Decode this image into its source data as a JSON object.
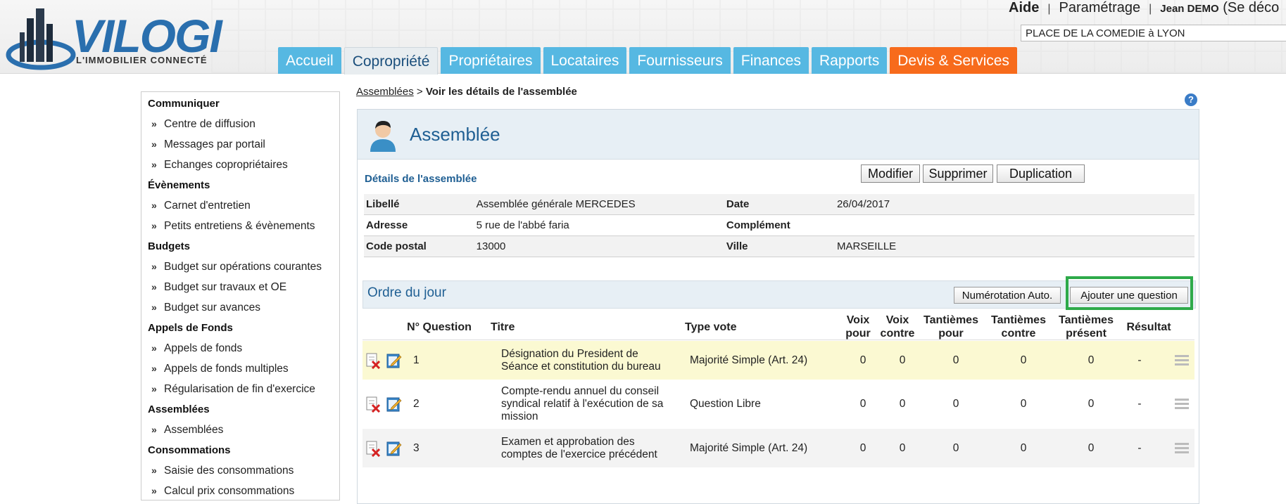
{
  "header": {
    "logo_text": "VILOGI",
    "logo_tagline": "L'IMMOBILIER CONNECTÉ",
    "links": {
      "aide": "Aide",
      "parametrage": "Paramétrage",
      "user": "Jean DEMO",
      "logout": "(Se déco"
    },
    "separator": "|",
    "copro_field": "PLACE DE LA COMEDIE à LYON",
    "tabs": [
      "Accueil",
      "Copropriété",
      "Propriétaires",
      "Locataires",
      "Fournisseurs",
      "Finances",
      "Rapports",
      "Devis & Services"
    ],
    "active_tab": "Copropriété"
  },
  "sidebar": {
    "groups": [
      {
        "title": "Communiquer",
        "items": [
          "Centre de diffusion",
          "Messages par portail",
          "Echanges copropriétaires"
        ]
      },
      {
        "title": "Évènements",
        "items": [
          "Carnet d'entretien",
          "Petits entretiens & évènements"
        ]
      },
      {
        "title": "Budgets",
        "items": [
          "Budget sur opérations courantes",
          "Budget sur travaux et OE",
          "Budget sur avances"
        ]
      },
      {
        "title": "Appels de Fonds",
        "items": [
          "Appels de fonds",
          "Appels de fonds multiples",
          "Régularisation de fin d'exercice"
        ]
      },
      {
        "title": "Assemblées",
        "items": [
          "Assemblées"
        ]
      },
      {
        "title": "Consommations",
        "items": [
          "Saisie des consommations",
          "Calcul prix consommations"
        ]
      }
    ],
    "chevron": "»"
  },
  "breadcrumb": {
    "link": "Assemblées",
    "sep": ">",
    "current": "Voir les détails de l'assemblée"
  },
  "help_icon": "?",
  "panel": {
    "title": "Assemblée",
    "details_label": "Détails de l'assemblée",
    "buttons": {
      "modifier": "Modifier",
      "supprimer": "Supprimer",
      "duplication": "Duplication"
    },
    "details": [
      {
        "k1": "Libellé",
        "v1": "Assemblée générale MERCEDES",
        "k2": "Date",
        "v2": "26/04/2017"
      },
      {
        "k1": "Adresse",
        "v1": "5 rue de l'abbé faria",
        "k2": "Complément",
        "v2": ""
      },
      {
        "k1": "Code postal",
        "v1": "13000",
        "k2": "Ville",
        "v2": "MARSEILLE"
      }
    ]
  },
  "odj": {
    "title": "Ordre du jour",
    "btn_numerotation": "Numérotation Auto.",
    "btn_ajouter": "Ajouter une question",
    "headers": {
      "num": "N° Question",
      "titre": "Titre",
      "type": "Type vote",
      "voix_pour_1": "Voix",
      "voix_pour_2": "pour",
      "voix_contre_1": "Voix",
      "voix_contre_2": "contre",
      "tant_pour_1": "Tantièmes",
      "tant_pour_2": "pour",
      "tant_contre_1": "Tantièmes",
      "tant_contre_2": "contre",
      "tant_present_1": "Tantièmes",
      "tant_present_2": "présent",
      "resultat": "Résultat"
    },
    "rows": [
      {
        "num": "1",
        "titre": "Désignation du President de Séance et constitution du bureau",
        "type": "Majorité Simple (Art. 24)",
        "voix_pour": "0",
        "voix_contre": "0",
        "tant_pour": "0",
        "tant_contre": "0",
        "tant_present": "0",
        "resultat": "-"
      },
      {
        "num": "2",
        "titre": "Compte-rendu annuel du conseil syndical relatif à l'exécution de sa mission",
        "type": "Question Libre",
        "voix_pour": "0",
        "voix_contre": "0",
        "tant_pour": "0",
        "tant_contre": "0",
        "tant_present": "0",
        "resultat": "-"
      },
      {
        "num": "3",
        "titre": "Examen et approbation des comptes de l'exercice précédent",
        "type": "Majorité Simple (Art. 24)",
        "voix_pour": "0",
        "voix_contre": "0",
        "tant_pour": "0",
        "tant_contre": "0",
        "tant_present": "0",
        "resultat": "-"
      }
    ]
  },
  "colors": {
    "tab": "#56b8e2",
    "tab_devis": "#f76b1c",
    "title_blue": "#1f5f93",
    "highlight": "#2eaa4a",
    "row_yellow": "#fbf9d2"
  }
}
